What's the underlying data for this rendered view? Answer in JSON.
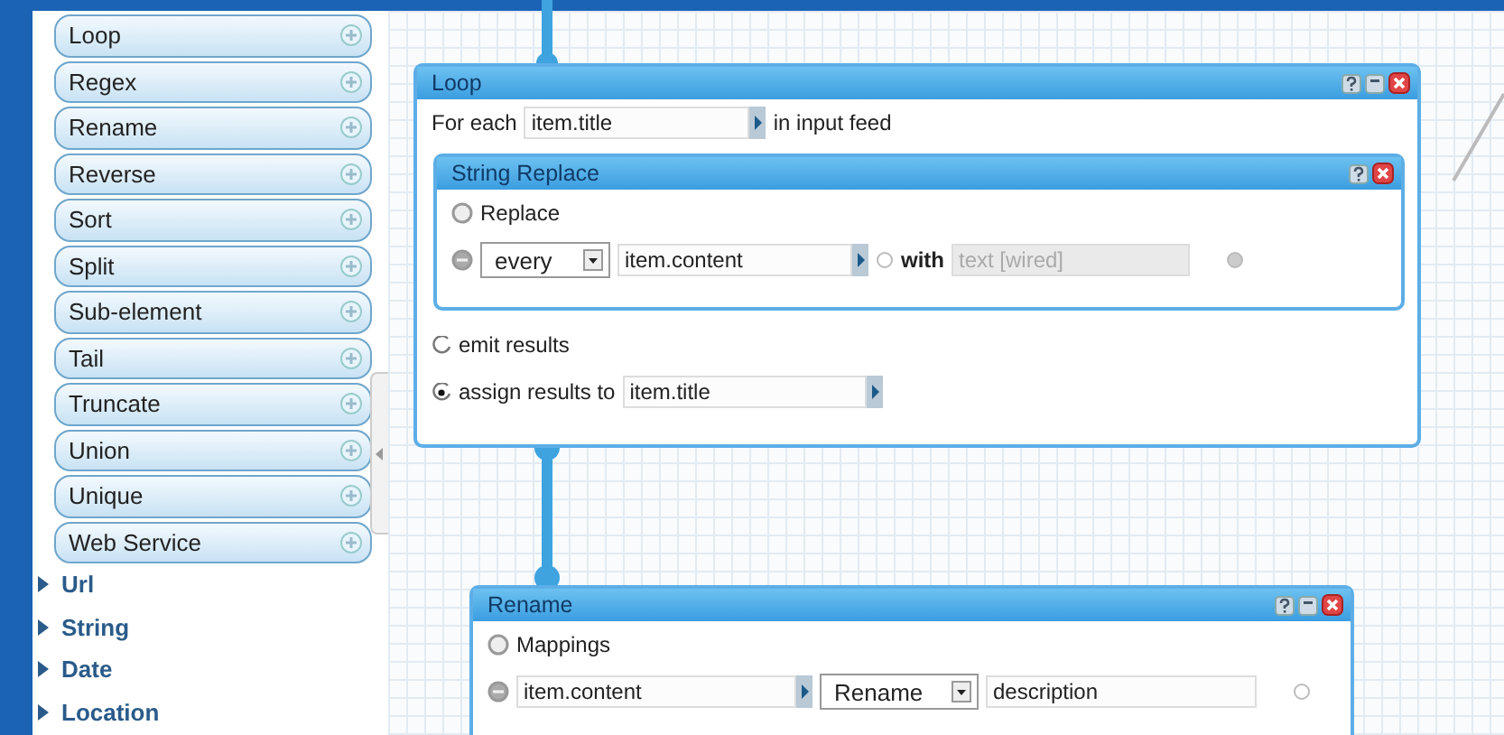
{
  "sidebar": {
    "modules": [
      {
        "label": "Loop"
      },
      {
        "label": "Regex"
      },
      {
        "label": "Rename"
      },
      {
        "label": "Reverse"
      },
      {
        "label": "Sort"
      },
      {
        "label": "Split"
      },
      {
        "label": "Sub-element"
      },
      {
        "label": "Tail"
      },
      {
        "label": "Truncate"
      },
      {
        "label": "Union"
      },
      {
        "label": "Unique"
      },
      {
        "label": "Web Service"
      }
    ],
    "categories": [
      {
        "label": "Url",
        "expanded": false
      },
      {
        "label": "String",
        "expanded": false
      },
      {
        "label": "Date",
        "expanded": false
      },
      {
        "label": "Location",
        "expanded": false
      }
    ]
  },
  "loop_module": {
    "title": "Loop",
    "for_each_label": "For each",
    "field": "item.title",
    "in_label": "in input feed",
    "inner": {
      "title": "String Replace",
      "section_label": "Replace",
      "mode": "every",
      "field": "item.content",
      "with_label": "with",
      "with_value": "text [wired]"
    },
    "outputs": [
      {
        "label": "emit results",
        "selected": false
      },
      {
        "label": "assign results to",
        "selected": true,
        "field": "item.title"
      }
    ]
  },
  "rename_module": {
    "title": "Rename",
    "section_label": "Mappings",
    "rows": [
      {
        "field": "item.content",
        "action": "Rename",
        "value": "description"
      }
    ]
  }
}
